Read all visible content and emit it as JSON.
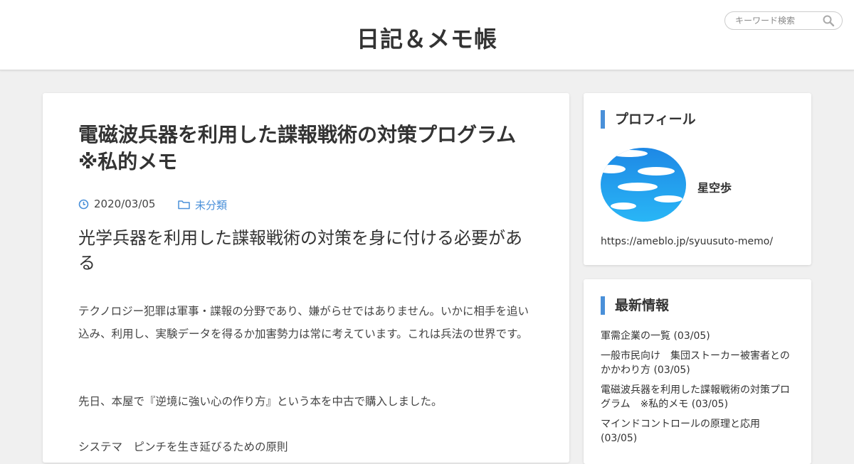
{
  "header": {
    "site_title": "日記＆メモ帳",
    "search_placeholder": "キーワード検索"
  },
  "article": {
    "title": "電磁波兵器を利用した諜報戦術の対策プログラム　※私的メモ",
    "date": "2020/03/05",
    "category": "未分類",
    "heading": "光学兵器を利用した諜報戦術の対策を身に付ける必要がある",
    "paragraphs": [
      "テクノロジー犯罪は軍事・諜報の分野であり、嫌がらせではありません。いかに相手を追い込み、利用し、実験データを得るか加害勢力は常に考えています。これは兵法の世界です。",
      "先日、本屋で『逆境に強い心の作り方』という本を中古で購入しました。",
      "システマ　ピンチを生き延びるための原則"
    ]
  },
  "sidebar": {
    "profile": {
      "heading": "プロフィール",
      "name": "星空歩",
      "url": "https://ameblo.jp/syuusuto-memo/"
    },
    "news": {
      "heading": "最新情報",
      "items": [
        "軍需企業の一覧 (03/05)",
        "一般市民向け　集団ストーカー被害者とのかかわり方 (03/05)",
        "電磁波兵器を利用した諜報戦術の対策プログラム　※私的メモ (03/05)",
        "マインドコントロールの原理と応用 (03/05)"
      ]
    }
  },
  "colors": {
    "accent": "#4a90d9",
    "background": "#f0f0f0",
    "text": "#333333"
  },
  "icons": {
    "search": "search-icon",
    "date": "clock-icon",
    "category": "folder-icon"
  }
}
